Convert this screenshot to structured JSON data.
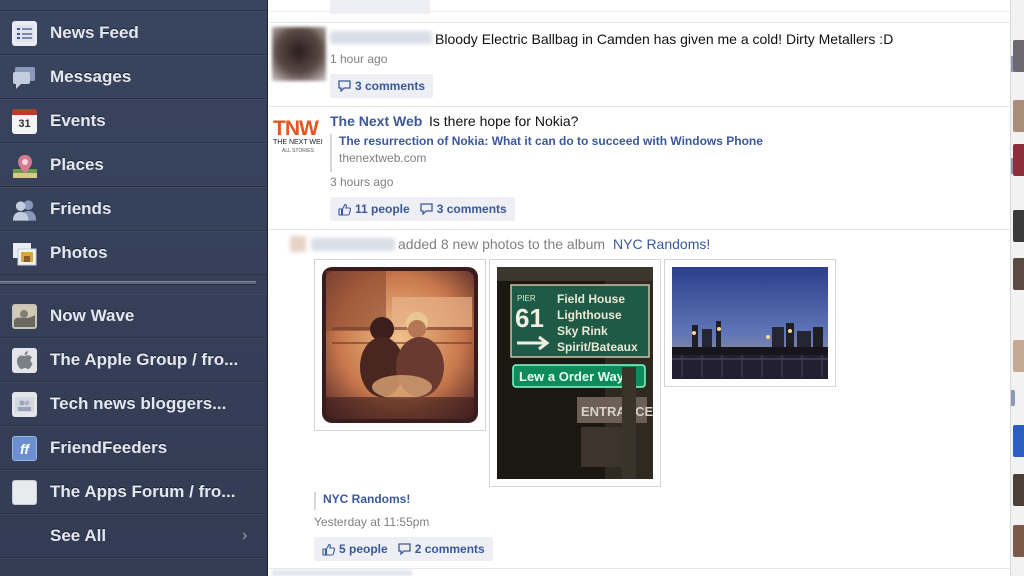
{
  "sidebar": {
    "items": [
      {
        "label": "News Feed",
        "icon": "news-feed-icon"
      },
      {
        "label": "Messages",
        "icon": "messages-icon"
      },
      {
        "label": "Events",
        "icon": "events-calendar-icon",
        "icon_text": "31"
      },
      {
        "label": "Places",
        "icon": "places-pin-icon"
      },
      {
        "label": "Friends",
        "icon": "friends-icon"
      },
      {
        "label": "Photos",
        "icon": "photos-icon"
      }
    ],
    "groups": [
      {
        "label": "Now Wave",
        "icon": "group-now-wave-icon"
      },
      {
        "label": "The Apple Group / fro...",
        "icon": "apple-logo-icon"
      },
      {
        "label": "Tech news bloggers...",
        "icon": "group-default-icon"
      },
      {
        "label": "FriendFeeders",
        "icon": "friendfeed-icon",
        "icon_text": "ff"
      },
      {
        "label": "The Apps Forum / fro...",
        "icon": "group-default-icon"
      }
    ],
    "see_all": "See All",
    "see_all_icon": "chevron-right-icon"
  },
  "feed": {
    "story1": {
      "text": "Bloody Electric Ballbag in Camden has given me a cold! Dirty Metallers :D",
      "time": "1 hour ago",
      "comments": "3 comments"
    },
    "story2": {
      "author": "The Next Web",
      "text": "Is there hope for Nokia?",
      "logo_text": "TNW",
      "logo_sub": "THE NEXT WEI",
      "logo_sub2": "ALL STORIES",
      "link_title": "The resurrection of Nokia: What it can do to succeed with Windows Phone",
      "link_domain": "thenextweb.com",
      "time": "3 hours ago",
      "likes": "11 people",
      "comments": "3 comments"
    },
    "story3": {
      "text_prefix": "added 8 new photos to the album",
      "album": "NYC Randoms!",
      "album_link": "NYC Randoms!",
      "time": "Yesterday at 11:55pm",
      "likes": "5 people",
      "comments": "2 comments",
      "sign": {
        "pier": "PIER",
        "number": "61",
        "lines": [
          "Field House",
          "Lighthouse",
          "Sky Rink",
          "Spirit/Bateaux"
        ],
        "street": "Lew a Order Way",
        "entrance": "ENTRANCE"
      }
    }
  },
  "colors": {
    "sidebar_bg": "#36415a",
    "link_blue": "#3b5998",
    "pill_bg": "#edeff4",
    "tnw_orange": "#e8541d"
  }
}
